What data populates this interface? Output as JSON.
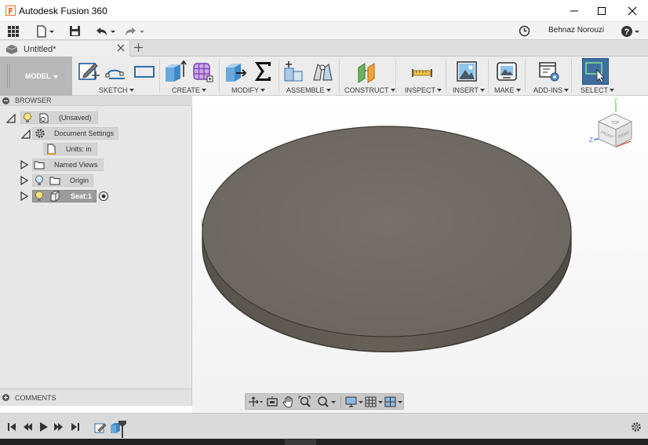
{
  "window": {
    "title": "Autodesk Fusion 360",
    "controls": [
      "minimize-icon",
      "maximize-icon",
      "close-icon"
    ]
  },
  "quick_access": {
    "icons": [
      "grid-menu-icon",
      "file-icon",
      "save-icon",
      "undo-icon",
      "redo-icon",
      "clock-icon",
      "help-icon"
    ],
    "user_name": "Behnaz Norouzi"
  },
  "tabs": {
    "active_title": "Untitled*",
    "new_tab_icon": "plus-icon"
  },
  "toolbar": {
    "workspace": "MODEL",
    "groups": [
      {
        "label": "SKETCH",
        "icons": [
          "create-sketch-icon",
          "line-icon",
          "rectangle-icon"
        ]
      },
      {
        "label": "CREATE",
        "icons": [
          "extrude-icon",
          "create-form-icon"
        ]
      },
      {
        "label": "MODIFY",
        "icons": [
          "press-pull-icon",
          "parameters-icon"
        ]
      },
      {
        "label": "ASSEMBLE",
        "icons": [
          "new-component-icon",
          "joint-icon"
        ]
      },
      {
        "label": "CONSTRUCT",
        "icons": [
          "offset-plane-icon"
        ]
      },
      {
        "label": "INSPECT",
        "icons": [
          "measure-icon"
        ]
      },
      {
        "label": "INSERT",
        "icons": [
          "insert-image-icon"
        ]
      },
      {
        "label": "MAKE",
        "icons": [
          "make-icon"
        ]
      },
      {
        "label": "ADD-INS",
        "icons": [
          "scripts-icon"
        ]
      },
      {
        "label": "SELECT",
        "icons": [
          "select-icon"
        ]
      }
    ]
  },
  "browser": {
    "title": "BROWSER",
    "items": [
      {
        "label": "(Unsaved)"
      },
      {
        "label": "Document Settings"
      },
      {
        "label": "Units: in"
      },
      {
        "label": "Named Views"
      },
      {
        "label": "Origin"
      },
      {
        "label": "Seat:1"
      }
    ]
  },
  "comments": {
    "title": "COMMENTS"
  },
  "viewcube": {
    "faces": [
      "TOP",
      "FRONT",
      "RIGHT"
    ],
    "axes": [
      "Y",
      "X",
      "Z"
    ]
  },
  "colors": {
    "model_top": "#706b64",
    "model_side": "#5b5750",
    "select_accent": "#3c6fa0"
  },
  "nav_bar": {
    "icons": [
      "orbit-icon",
      "look-at-icon",
      "pan-icon",
      "zoom-window-icon",
      "zoom-icon",
      "display-settings-icon",
      "grid-icon",
      "viewports-icon"
    ]
  },
  "timeline": {
    "icons": [
      "first-icon",
      "previous-icon",
      "play-icon",
      "next-icon",
      "last-icon",
      "sketch-feature-icon",
      "extrude-feature-icon",
      "marker-icon",
      "settings-icon"
    ]
  }
}
